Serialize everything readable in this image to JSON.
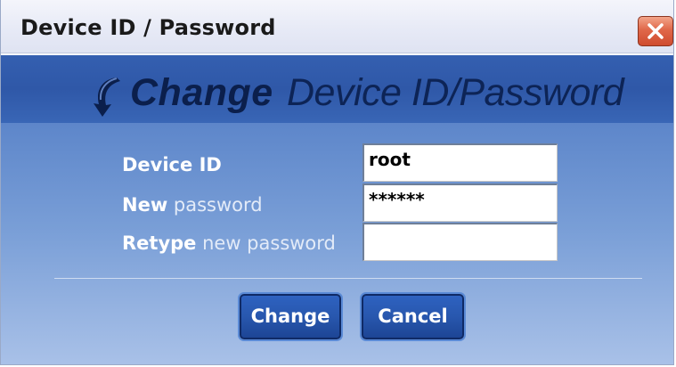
{
  "window": {
    "title": "Device ID / Password"
  },
  "header": {
    "heading_bold": "Change",
    "heading_rest": "Device ID/Password"
  },
  "form": {
    "device_id": {
      "label_bold": "Device ID",
      "label_rest": "",
      "value": "root"
    },
    "new_password": {
      "label_bold": "New",
      "label_rest": " password",
      "value": "******"
    },
    "retype_password": {
      "label_bold": "Retype",
      "label_rest": " new password",
      "value": ""
    }
  },
  "buttons": {
    "change_label": "Change",
    "cancel_label": "Cancel"
  },
  "icons": {
    "close": "close-icon",
    "header": "refresh-arrow-icon"
  },
  "colors": {
    "header_band": "#2f58a8",
    "button": "#2857ae",
    "close_button": "#e0684a"
  }
}
